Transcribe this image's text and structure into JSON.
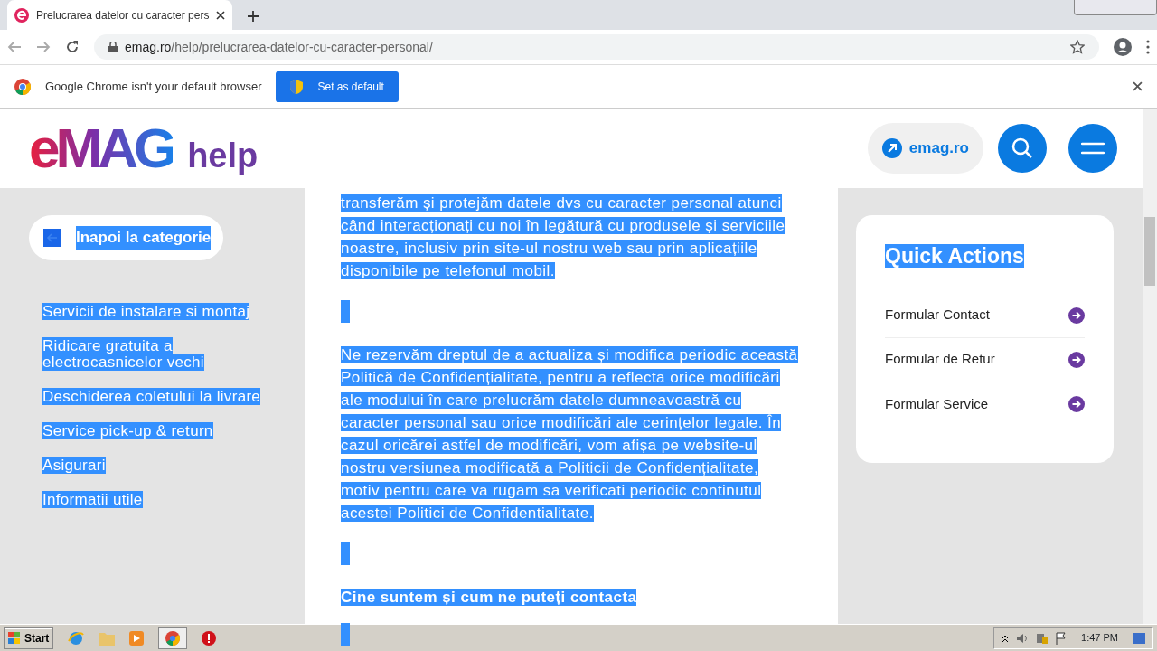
{
  "browser": {
    "tab_title": "Prelucrarea datelor cu caracter pers",
    "url_host": "emag.ro",
    "url_path": "/help/prelucrarea-datelor-cu-caracter-personal/",
    "infobar_message": "Google Chrome isn't your default browser",
    "infobar_button": "Set as default"
  },
  "text_selection": true,
  "header": {
    "logo": "eMAG",
    "logo_suffix": "help",
    "site_link": "emag.ro"
  },
  "sidebar": {
    "back": "Inapoi la categorie",
    "items": [
      {
        "label": "Servicii de instalare si montaj"
      },
      {
        "label": "Ridicare gratuita a electrocasnicelor vechi"
      },
      {
        "label": "Deschiderea coletului la livrare"
      },
      {
        "label": "Service pick-up & return"
      },
      {
        "label": "Asigurari"
      },
      {
        "label": "Informatii utile"
      }
    ]
  },
  "article": {
    "blocks": [
      {
        "kind": "paragraph",
        "text": "transferăm și protejăm datele dvs cu caracter personal atunci când interacționați cu noi în legătură cu produsele și serviciile noastre, inclusiv prin site-ul nostru web sau prin aplicațiile disponibile pe telefonul mobil."
      },
      {
        "kind": "blank"
      },
      {
        "kind": "paragraph",
        "text": "Ne rezervăm dreptul de a actualiza și modifica periodic această Politică de Confidențialitate, pentru a reflecta orice modificări ale modului în care prelucrăm datele dumneavoastră cu caracter personal sau orice modificări ale cerințelor legale. În cazul oricărei astfel de modificări, vom afișa pe website-ul nostru versiunea modificată a Politicii de Confidențialitate, motiv pentru care va rugam sa verificati periodic continutul acestei Politici de Confidentialitate."
      },
      {
        "kind": "blank"
      },
      {
        "kind": "heading",
        "text": "Cine suntem și cum ne puteți contacta"
      },
      {
        "kind": "blank"
      }
    ]
  },
  "quick_actions": {
    "title": "Quick Actions",
    "items": [
      {
        "label": "Formular Contact"
      },
      {
        "label": "Formular de Retur"
      },
      {
        "label": "Formular Service"
      }
    ]
  },
  "taskbar": {
    "start": "Start",
    "clock": "1:47 PM"
  }
}
